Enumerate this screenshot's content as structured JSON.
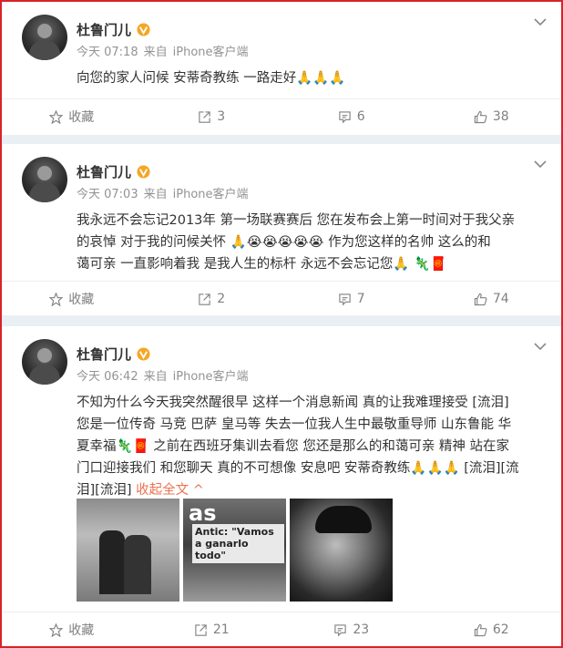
{
  "posts": [
    {
      "author": "杜鲁门儿",
      "time": "今天 07:18",
      "source_prefix": "来自",
      "source": "iPhone客户端",
      "text": "向您的家人问候 安蒂奇教练 一路走好🙏🙏🙏",
      "actions": {
        "favorite": "收藏",
        "repost": "3",
        "comment": "6",
        "like": "38"
      }
    },
    {
      "author": "杜鲁门儿",
      "time": "今天 07:03",
      "source_prefix": "来自",
      "source": "iPhone客户端",
      "text_lines": [
        "我永远不会忘记2013年 第一场联赛赛后 您在发布会上第一时间对于我父亲",
        "的哀悼 对于我的问候关怀 🙏😭😭😭😭😭 作为您这样的名帅 这么的和",
        "蔼可亲 一直影响着我 是我人生的标杆 永远不会忘记您🙏 🦎🧧"
      ],
      "actions": {
        "favorite": "收藏",
        "repost": "2",
        "comment": "7",
        "like": "74"
      }
    },
    {
      "author": "杜鲁门儿",
      "time": "今天 06:42",
      "source_prefix": "来自",
      "source": "iPhone客户端",
      "text_lines": [
        "不知为什么今天我突然醒很早 这样一个消息新闻 真的让我难理接受 [流泪]",
        "您是一位传奇 马竞 巴萨 皇马等 失去一位我人生中最敬重导师 山东鲁能 华",
        "夏幸福🦎🧧 之前在西班牙集训去看您 您还是那么的和蔼可亲 精神 站在家",
        "门口迎接我们 和您聊天 真的不可想像 安息吧 安蒂奇教练🙏🙏🙏 [流泪][流",
        "泪][流泪]"
      ],
      "collapse": "收起全文",
      "collapse_arrow": "^",
      "photo2": {
        "masthead": "as",
        "headline": "Antic: \"Vamos a ganarlo todo\""
      },
      "actions": {
        "favorite": "收藏",
        "repost": "21",
        "comment": "23",
        "like": "62"
      }
    }
  ],
  "colors": {
    "frame": "#d8232a",
    "link": "#eb7350",
    "badge": "#f5a623"
  }
}
